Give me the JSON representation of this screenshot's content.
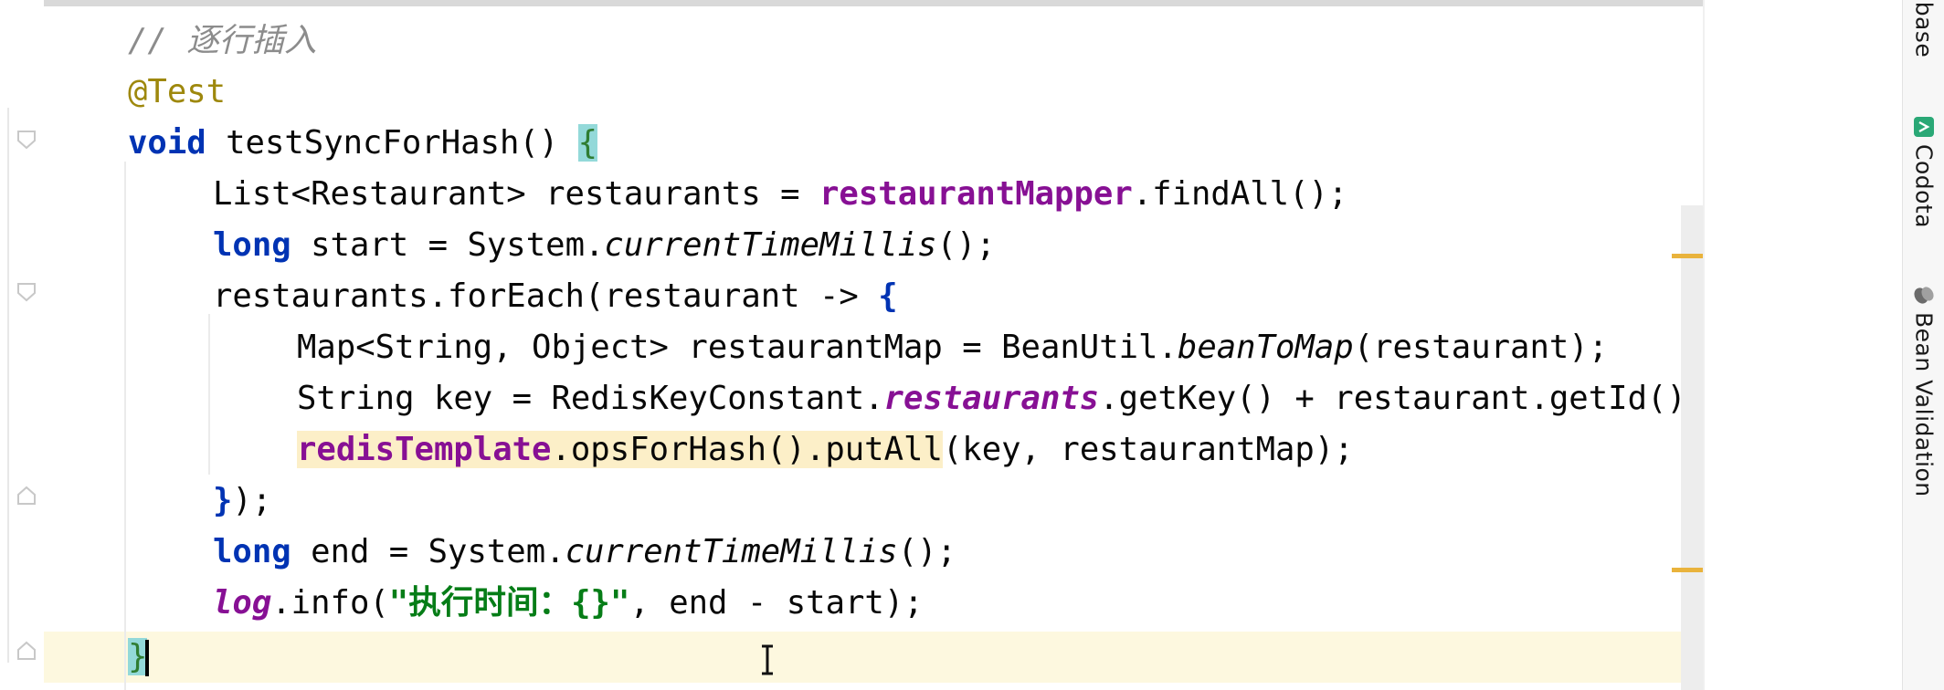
{
  "editor": {
    "lines": [
      {
        "parts": [
          {
            "t": "// ",
            "c": "comment"
          },
          {
            "t": "逐行插入",
            "c": "comment"
          }
        ]
      },
      {
        "parts": [
          {
            "t": "@Test",
            "c": "annot"
          }
        ]
      },
      {
        "parts": [
          {
            "t": "void",
            "c": "kw"
          },
          {
            "t": " testSyncForHash() "
          },
          {
            "t": "{",
            "c": "brace-hl brace-green"
          }
        ]
      },
      {
        "parts": [
          {
            "t": "List<Restaurant> restaurants = "
          },
          {
            "t": "restaurantMapper",
            "c": "field"
          },
          {
            "t": ".findAll();"
          }
        ]
      },
      {
        "parts": [
          {
            "t": "long",
            "c": "kw"
          },
          {
            "t": " start = System."
          },
          {
            "t": "currentTimeMillis",
            "c": "static"
          },
          {
            "t": "();"
          }
        ]
      },
      {
        "parts": [
          {
            "t": "restaurants.forEach(restaurant -> "
          },
          {
            "t": "{",
            "c": "kw"
          }
        ]
      },
      {
        "parts": [
          {
            "t": "Map<String, Object> restaurantMap = BeanUtil."
          },
          {
            "t": "beanToMap",
            "c": "static"
          },
          {
            "t": "(restaurant);"
          }
        ]
      },
      {
        "parts": [
          {
            "t": "String key = RedisKeyConstant."
          },
          {
            "t": "restaurants",
            "c": "static-field"
          },
          {
            "t": ".getKey() + restaurant.getId();"
          }
        ]
      },
      {
        "parts": [
          {
            "t": "redisTemplate",
            "c": "field usage-hl"
          },
          {
            "t": ".opsForHash().putAll",
            "c": "usage-hl"
          },
          {
            "t": "(key, restaurantMap);"
          }
        ]
      },
      {
        "parts": [
          {
            "t": "}",
            "c": "kw"
          },
          {
            "t": ");"
          }
        ]
      },
      {
        "parts": [
          {
            "t": "long",
            "c": "kw"
          },
          {
            "t": " end = System."
          },
          {
            "t": "currentTimeMillis",
            "c": "static"
          },
          {
            "t": "();"
          }
        ]
      },
      {
        "parts": [
          {
            "t": "log",
            "c": "static-field"
          },
          {
            "t": ".info("
          },
          {
            "t": "\"执行时间：{}\"",
            "c": "str"
          },
          {
            "t": ", end - start);"
          }
        ]
      },
      {
        "parts": [
          {
            "t": "}",
            "c": "brace-hl brace-green"
          }
        ]
      }
    ]
  },
  "side_panel": {
    "tabs": [
      {
        "label": "Database",
        "icon": "database-icon"
      },
      {
        "label": "Codota",
        "icon": "codota-icon"
      },
      {
        "label": "Bean Validation",
        "icon": "bean-validation-icon"
      }
    ]
  }
}
